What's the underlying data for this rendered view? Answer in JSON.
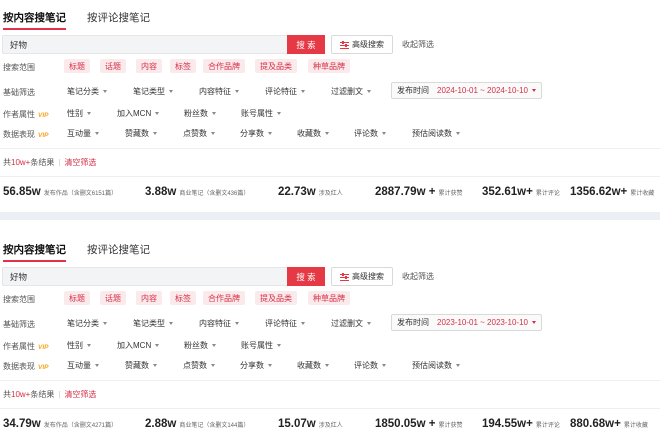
{
  "panels": [
    {
      "tabs": {
        "content": "按内容搜笔记",
        "comment": "按评论搜笔记"
      },
      "search": {
        "value": "好物",
        "button": "搜 索",
        "advanced": "高级搜索",
        "collapse": "收起筛选"
      },
      "scope": {
        "label": "搜索范围",
        "chips": [
          "标题",
          "话题",
          "内容",
          "标签",
          "合作品牌",
          "提及品类",
          "种草品牌"
        ]
      },
      "basic": {
        "label": "基础筛选",
        "items": [
          "笔记分类",
          "笔记类型",
          "内容特征",
          "评论特征",
          "过滤删文"
        ],
        "date_label": "发布时间",
        "date_value": "2024-10-01 ~ 2024-10-10"
      },
      "author": {
        "label": "作者属性",
        "vip": "VIP",
        "items": [
          "性别",
          "加入MCN",
          "粉丝数",
          "账号属性"
        ]
      },
      "data": {
        "label": "数据表现",
        "vip": "VIP",
        "items": [
          "互动量",
          "赞藏数",
          "点赞数",
          "分享数",
          "收藏数",
          "评论数",
          "预估阅读数"
        ]
      },
      "result": {
        "prefix": "共",
        "count": "10w+",
        "suffix": "条结果",
        "clear": "清空筛选"
      },
      "stats": [
        {
          "num": "56.85w",
          "label": "发布作品（含删文6151篇）"
        },
        {
          "num": "3.88w",
          "label": "商业笔记（含删文436篇）"
        },
        {
          "num": "22.73w",
          "label": "涉及红人"
        },
        {
          "num": "2887.79w +",
          "label": "累计获赞"
        },
        {
          "num": "352.61w+",
          "label": "累计评论"
        },
        {
          "num": "1356.62w+",
          "label": "累计收藏"
        }
      ]
    },
    {
      "tabs": {
        "content": "按内容搜笔记",
        "comment": "按评论搜笔记"
      },
      "search": {
        "value": "好物",
        "button": "搜 索",
        "advanced": "高级搜索",
        "collapse": "收起筛选"
      },
      "scope": {
        "label": "搜索范围",
        "chips": [
          "标题",
          "话题",
          "内容",
          "标签",
          "合作品牌",
          "提及品类",
          "种草品牌"
        ]
      },
      "basic": {
        "label": "基础筛选",
        "items": [
          "笔记分类",
          "笔记类型",
          "内容特征",
          "评论特征",
          "过滤删文"
        ],
        "date_label": "发布时间",
        "date_value": "2023-10-01 ~ 2023-10-10"
      },
      "author": {
        "label": "作者属性",
        "vip": "VIP",
        "items": [
          "性别",
          "加入MCN",
          "粉丝数",
          "账号属性"
        ]
      },
      "data": {
        "label": "数据表现",
        "vip": "VIP",
        "items": [
          "互动量",
          "赞藏数",
          "点赞数",
          "分享数",
          "收藏数",
          "评论数",
          "预估阅读数"
        ]
      },
      "result": {
        "prefix": "共",
        "count": "10w+",
        "suffix": "条结果",
        "clear": "清空筛选"
      },
      "stats": [
        {
          "num": "34.79w",
          "label": "发布作品（含删文4271篇）"
        },
        {
          "num": "2.88w",
          "label": "商业笔记（含删文144篇）"
        },
        {
          "num": "15.07w",
          "label": "涉及红人"
        },
        {
          "num": "1850.05w +",
          "label": "累计获赞"
        },
        {
          "num": "194.55w+",
          "label": "累计评论"
        },
        {
          "num": "880.68w+",
          "label": "累计收藏"
        }
      ]
    }
  ],
  "colors": {
    "accent": "#e63946",
    "chip_bg": "#fbeaec",
    "chip_text": "#d72f46",
    "vip": "#f5a623"
  }
}
